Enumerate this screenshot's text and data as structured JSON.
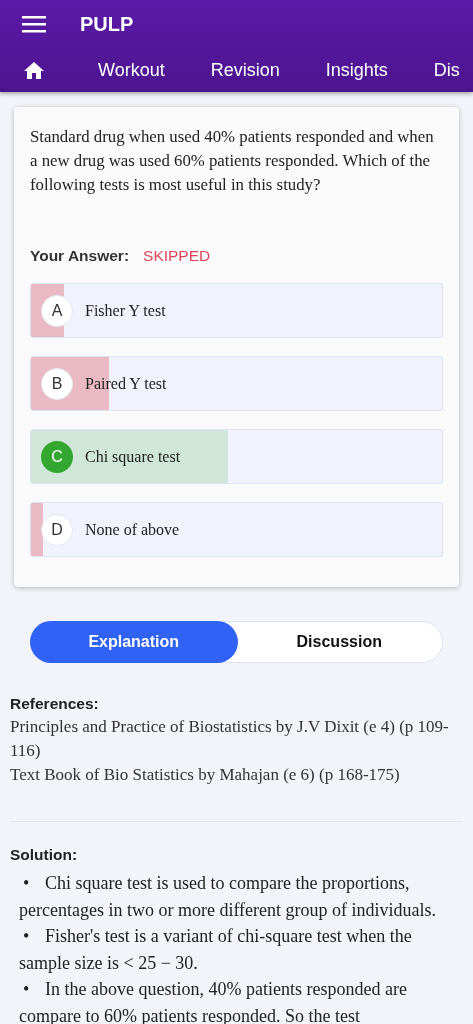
{
  "app_bar": {
    "title": "PULP"
  },
  "tabs": [
    {
      "label": "Workout"
    },
    {
      "label": "Revision"
    },
    {
      "label": "Insights"
    },
    {
      "label": "Dis"
    }
  ],
  "question": {
    "text": "Standard drug when used 40% patients responded and when a new drug was used 60% patients responded. Which of the following tests is most useful in this study?",
    "answer_label": "Your Answer:",
    "answer_value": "SKIPPED",
    "options": [
      {
        "letter": "A",
        "text": "Fisher Y test",
        "correct": false,
        "level": 0.08
      },
      {
        "letter": "B",
        "text": "Paired Y test",
        "correct": false,
        "level": 0.19
      },
      {
        "letter": "C",
        "text": "Chi square test",
        "correct": true,
        "level": 0.48
      },
      {
        "letter": "D",
        "text": "None of above",
        "correct": false,
        "level": 0.03
      }
    ]
  },
  "toggle": [
    {
      "label": "Explanation",
      "selected": true
    },
    {
      "label": "Discussion",
      "selected": false
    }
  ],
  "references": {
    "heading": "References:",
    "items": [
      "Principles and Practice of Biostatistics by J.V Dixit (e 4) (p 109-116)",
      "Text Book of Bio Statistics by Mahajan (e 6) (p 168-175)"
    ]
  },
  "solution": {
    "heading": "Solution:",
    "items": [
      {
        "bullet": "•",
        "text": "Chi square test is used to compare the proportions, percentages in two or more different group of individuals."
      },
      {
        "bullet": "•",
        "text": "Fisher's test is a variant of chi-square test when the sample size is < 25 − 30."
      },
      {
        "bullet": "•",
        "text": "In the above question, 40% patients responded are compare to 60% patients responded. So the test"
      }
    ]
  }
}
